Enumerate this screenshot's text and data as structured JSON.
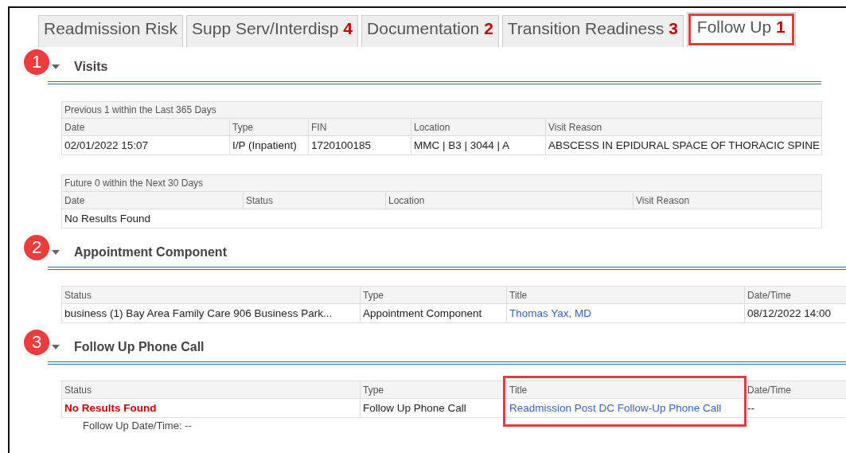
{
  "tabs": [
    {
      "label": "Readmission Risk",
      "selected": false,
      "highlighted": false
    },
    {
      "label": "Supp Serv/Interdisp",
      "count": "4",
      "selected": false,
      "highlighted": false
    },
    {
      "label": "Documentation",
      "count": "2",
      "selected": false,
      "highlighted": false
    },
    {
      "label": "Transition Readiness",
      "count": "3",
      "selected": false,
      "highlighted": false
    },
    {
      "label": "Follow Up",
      "count": "1",
      "selected": true,
      "highlighted": true
    }
  ],
  "sections": [
    {
      "marker": "1",
      "title": "Visits",
      "expanded": true,
      "tables": [
        {
          "caption": "Previous 1 within the Last 365 Days",
          "columns": [
            {
              "label": "Date"
            },
            {
              "label": "Type"
            },
            {
              "label": "FIN"
            },
            {
              "label": "Location"
            },
            {
              "label": "Visit Reason"
            }
          ],
          "rows": [
            [
              {
                "text": "02/01/2022 15:07",
                "kind": "text"
              },
              {
                "text": "I/P (Inpatient)",
                "kind": "text"
              },
              {
                "text": "1720100185",
                "kind": "text"
              },
              {
                "text": "MMC  | B3  | 3044  | A",
                "kind": "text"
              },
              {
                "text": "ABSCESS IN EPIDURAL SPACE OF THORACIC SPINE",
                "kind": "text"
              }
            ]
          ]
        },
        {
          "caption": "Future 0 within the Next 30 Days",
          "columns": [
            {
              "label": "Date"
            },
            {
              "label": "Status"
            },
            {
              "label": "Location"
            },
            {
              "label": "Visit Reason"
            }
          ],
          "empty_text": "No Results Found"
        }
      ]
    },
    {
      "marker": "2",
      "title": "Appointment Component",
      "expanded": true,
      "tables": [
        {
          "columns": [
            {
              "label": "Status"
            },
            {
              "label": "Type"
            },
            {
              "label": "Title"
            },
            {
              "label": "Date/Time"
            }
          ],
          "rows": [
            [
              {
                "text": "business (1) Bay Area Family Care 906 Business Park...",
                "kind": "text"
              },
              {
                "text": "Appointment Component",
                "kind": "text"
              },
              {
                "text": "Thomas Yax, MD",
                "kind": "link"
              },
              {
                "text": "08/12/2022 14:00",
                "kind": "text"
              }
            ]
          ]
        }
      ]
    },
    {
      "marker": "3",
      "title": "Follow Up Phone Call",
      "expanded": true,
      "tables": [
        {
          "columns": [
            {
              "label": "Status",
              "highlighted": false
            },
            {
              "label": "Type",
              "highlighted": false
            },
            {
              "label": "Title",
              "highlighted": true
            },
            {
              "label": "Date/Time",
              "highlighted": false
            }
          ],
          "rows": [
            [
              {
                "text": "No Results Found",
                "kind": "alert"
              },
              {
                "text": "Follow Up Phone Call",
                "kind": "text"
              },
              {
                "text": "Readmission Post DC Follow-Up Phone Call",
                "kind": "link"
              },
              {
                "text": "--",
                "kind": "text"
              }
            ]
          ]
        }
      ],
      "note": "Follow Up Date/Time: --"
    }
  ]
}
